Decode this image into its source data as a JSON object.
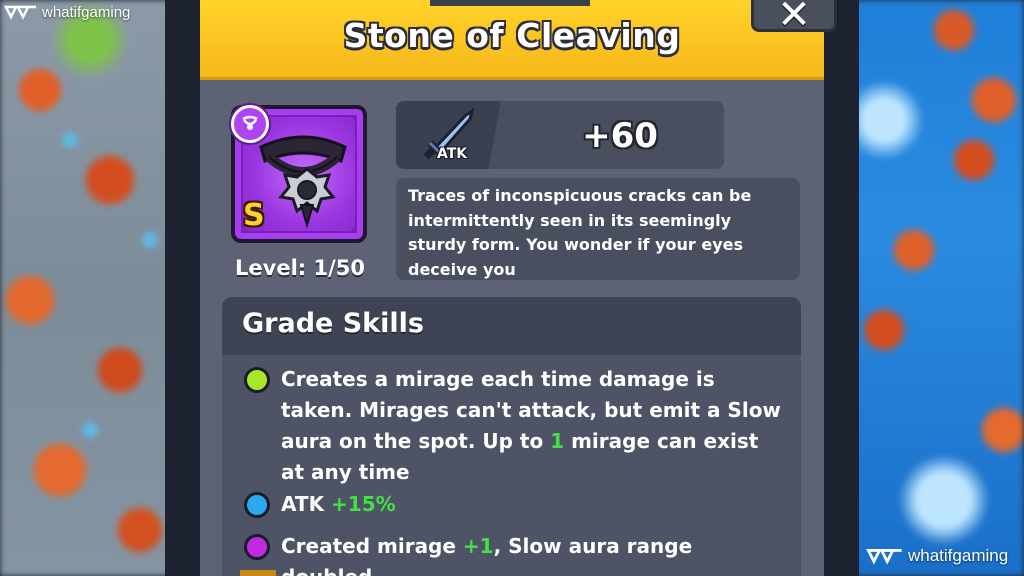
{
  "dialog": {
    "title": "Stone of Cleaving",
    "close_icon": "close-icon"
  },
  "item": {
    "grade_letter": "S",
    "level_text": "Level: 1/50",
    "icon": "necklace-pendant-icon",
    "badge_icon": "necklace-badge-icon",
    "rarity_color": "#9a36e0"
  },
  "stat": {
    "icon": "sword-icon",
    "label": "ATK",
    "value": "+60"
  },
  "description": "Traces of inconspicuous cracks can be intermittently seen in its seemingly sturdy form. You wonder if your eyes deceive you",
  "grade_skills": {
    "header": "Grade Skills",
    "skills": [
      {
        "dot_color": "#a8e62a",
        "text_a": "Creates a mirage each time damage is taken. Mirages can't attack, but emit a Slow aura on the spot. Up to ",
        "highlight": "1",
        "text_b": " mirage can exist at any time"
      },
      {
        "dot_color": "#2aa8f0",
        "text_a": "ATK ",
        "highlight": "+15%",
        "text_b": ""
      },
      {
        "dot_color": "#c02ae0",
        "text_a": "Created mirage ",
        "highlight": "+1",
        "text_b": ", Slow aura range doubled"
      }
    ],
    "highlight_color": "#43e043"
  },
  "watermark": {
    "text": "whatifgaming"
  }
}
